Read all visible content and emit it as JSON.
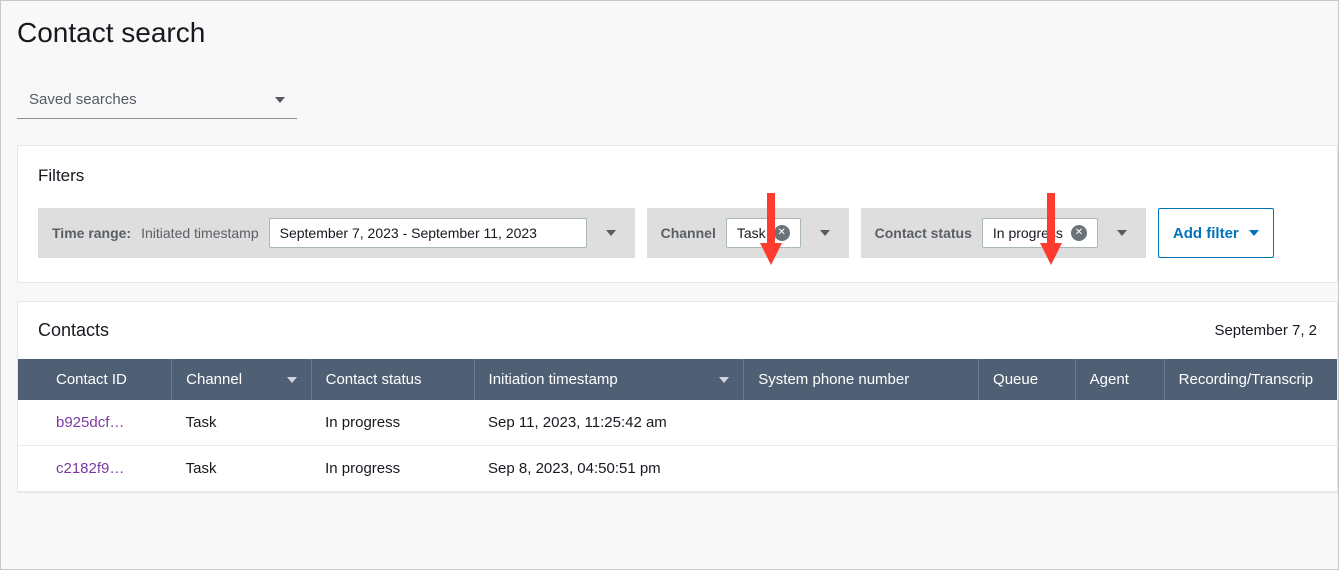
{
  "page": {
    "title": "Contact search",
    "saved_searches_label": "Saved searches"
  },
  "filters": {
    "title": "Filters",
    "time_range": {
      "label": "Time range:",
      "sublabel": "Initiated timestamp",
      "value": "September 7, 2023 - September 11, 2023"
    },
    "channel": {
      "label": "Channel",
      "value": "Task"
    },
    "contact_status": {
      "label": "Contact status",
      "value": "In progress"
    },
    "add_filter_label": "Add filter"
  },
  "contacts": {
    "title": "Contacts",
    "date_hint": "September 7, 2",
    "columns": {
      "contact_id": "Contact ID",
      "channel": "Channel",
      "contact_status": "Contact status",
      "initiation_timestamp": "Initiation timestamp",
      "system_phone_number": "System phone number",
      "queue": "Queue",
      "agent": "Agent",
      "recording": "Recording/Transcrip"
    },
    "rows": [
      {
        "contact_id": "b925dcf…",
        "channel": "Task",
        "contact_status": "In progress",
        "initiation_timestamp": "Sep 11, 2023, 11:25:42 am",
        "system_phone_number": "",
        "queue": "",
        "agent": "",
        "recording": ""
      },
      {
        "contact_id": "c2182f9…",
        "channel": "Task",
        "contact_status": "In progress",
        "initiation_timestamp": "Sep 8, 2023, 04:50:51 pm",
        "system_phone_number": "",
        "queue": "",
        "agent": "",
        "recording": ""
      }
    ]
  }
}
